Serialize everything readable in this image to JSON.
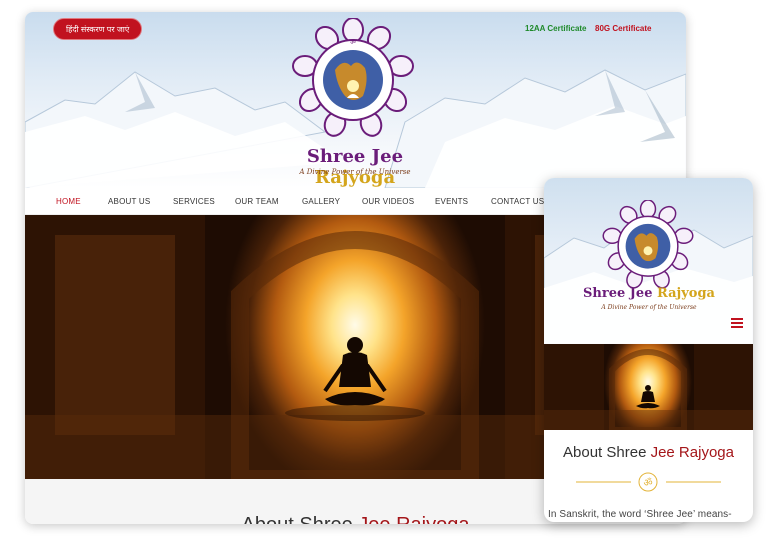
{
  "header": {
    "hindi_button": "हिंदी संस्करण पर जाएं",
    "certificates": [
      "12AA Certificate",
      "80G Certificate"
    ],
    "brand_part1": "Shree Jee ",
    "brand_part2": "Rajyoga",
    "tagline": "A Divine Power of the Universe"
  },
  "nav": {
    "items": [
      "HOME",
      "ABOUT US",
      "SERVICES",
      "OUR TEAM",
      "GALLERY",
      "OUR VIDEOS",
      "EVENTS",
      "CONTACT US"
    ],
    "active": "HOME"
  },
  "about": {
    "title_part1": "About Shree ",
    "title_part2": "Jee Rajyoga",
    "intro": "In Sanskrit, the word ‘Shree Jee’ means-"
  },
  "colors": {
    "accent_red": "#c1121f",
    "brand_purple": "#6b1d7a",
    "brand_gold": "#d4a51c",
    "cert_green": "#1f8a2b"
  },
  "icons": [
    "om-icon",
    "hamburger-menu-icon",
    "lotus-logo-icon",
    "yoga-meditation-figure"
  ]
}
